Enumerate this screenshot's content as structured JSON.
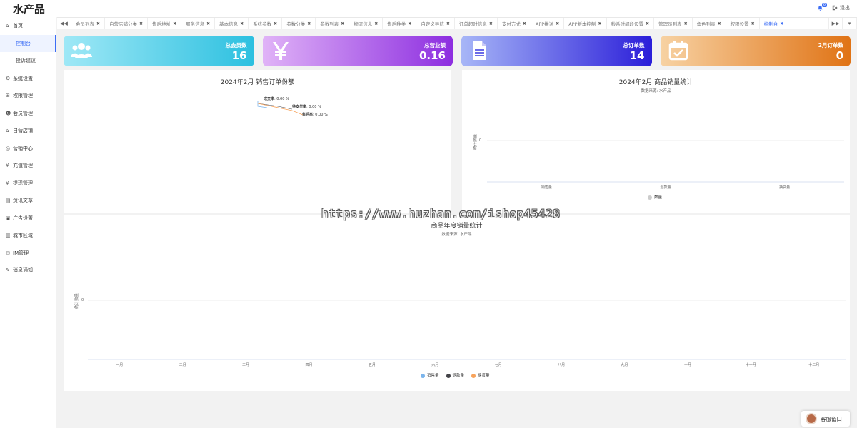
{
  "app": {
    "brand": "水产品",
    "notification_count": "0",
    "logout_label": "退出"
  },
  "sidebar": {
    "items": [
      {
        "label": "首页",
        "icon": "home-icon",
        "glyph": "⌂"
      },
      {
        "label": "控制台",
        "sub": true,
        "active": true
      },
      {
        "label": "投诉建议",
        "sub": true
      },
      {
        "label": "系统设置",
        "icon": "gear-icon",
        "glyph": "⚙"
      },
      {
        "label": "权限管理",
        "icon": "sitemap-icon",
        "glyph": "⊞"
      },
      {
        "label": "会员管理",
        "icon": "users-icon",
        "glyph": "☻"
      },
      {
        "label": "自营店铺",
        "icon": "bank-icon",
        "glyph": "⌂"
      },
      {
        "label": "营销中心",
        "icon": "target-icon",
        "glyph": "◎"
      },
      {
        "label": "充值管理",
        "icon": "yen-icon",
        "glyph": "¥"
      },
      {
        "label": "提现管理",
        "icon": "yen-icon",
        "glyph": "¥"
      },
      {
        "label": "资讯文章",
        "icon": "newspaper-icon",
        "glyph": "▤"
      },
      {
        "label": "广告设置",
        "icon": "image-icon",
        "glyph": "▣"
      },
      {
        "label": "城市区域",
        "icon": "map-icon",
        "glyph": "▥"
      },
      {
        "label": "IM管理",
        "icon": "chat-icon",
        "glyph": "✉"
      },
      {
        "label": "消息通知",
        "icon": "comment-icon",
        "glyph": "✎"
      }
    ]
  },
  "tabs": [
    {
      "label": "会员列表"
    },
    {
      "label": "自营店铺分类"
    },
    {
      "label": "售后地址"
    },
    {
      "label": "服务信息"
    },
    {
      "label": "基本信息"
    },
    {
      "label": "系统参数"
    },
    {
      "label": "参数分类"
    },
    {
      "label": "参数列表"
    },
    {
      "label": "物流信息"
    },
    {
      "label": "售后种类"
    },
    {
      "label": "自定义导航"
    },
    {
      "label": "订单超时信息"
    },
    {
      "label": "支付方式"
    },
    {
      "label": "APP推送"
    },
    {
      "label": "APP版本控制"
    },
    {
      "label": "秒杀时间段设置"
    },
    {
      "label": "管理员列表"
    },
    {
      "label": "角色列表"
    },
    {
      "label": "权限设置"
    },
    {
      "label": "控制台",
      "active": true
    }
  ],
  "stats": [
    {
      "label": "总会员数",
      "value": "16",
      "icon": "users-icon"
    },
    {
      "label": "总营业额",
      "value": "0.16",
      "icon": "yen-icon"
    },
    {
      "label": "总订单数",
      "value": "14",
      "icon": "document-icon"
    },
    {
      "label": "2月订单数",
      "value": "0",
      "icon": "calendar-check-icon"
    }
  ],
  "pie_chart": {
    "title": "2024年2月 销售订单份额",
    "labels": [
      {
        "name": "成交率",
        "value": "0.00 %"
      },
      {
        "name": "待支付率",
        "value": "0.00 %"
      },
      {
        "name": "售后率",
        "value": "0.00 %"
      }
    ]
  },
  "chart_data": [
    {
      "type": "pie",
      "title": "2024年2月 销售订单份额",
      "categories": [
        "成交率",
        "待支付率",
        "售后率"
      ],
      "values": [
        0,
        0,
        0
      ],
      "value_labels": [
        "0.00 %",
        "0.00 %",
        "0.00 %"
      ]
    },
    {
      "type": "bar",
      "title": "2024年2月 商品销量统计",
      "subtitle": "数据来源: 水产品",
      "ylabel": "统计数量",
      "categories": [
        "销售量",
        "退款量",
        "换货量"
      ],
      "series": [
        {
          "name": "数量",
          "values": [
            0,
            0,
            0
          ]
        }
      ],
      "yticks": [
        "0"
      ],
      "legend": "bottom",
      "colors": [
        "#cccccc"
      ]
    },
    {
      "type": "line",
      "title": "商品年度销量统计",
      "subtitle": "数据来源: 水产品",
      "ylabel": "统计数量",
      "categories": [
        "一月",
        "二月",
        "三月",
        "四月",
        "五月",
        "六月",
        "七月",
        "八月",
        "九月",
        "十月",
        "十一月",
        "十二月"
      ],
      "series": [
        {
          "name": "销售量",
          "values": [
            0,
            0,
            0,
            0,
            0,
            0,
            0,
            0,
            0,
            0,
            0,
            0
          ]
        },
        {
          "name": "退款量",
          "values": [
            0,
            0,
            0,
            0,
            0,
            0,
            0,
            0,
            0,
            0,
            0,
            0
          ]
        },
        {
          "name": "换货量",
          "values": [
            0,
            0,
            0,
            0,
            0,
            0,
            0,
            0,
            0,
            0,
            0,
            0
          ]
        }
      ],
      "yticks": [
        "0"
      ],
      "legend": "bottom",
      "colors": [
        "#7cb5ec",
        "#434348",
        "#f7a35c"
      ]
    }
  ],
  "watermark": "https://www.huzhan.com/ishop45428",
  "service": {
    "label": "客服留口"
  }
}
